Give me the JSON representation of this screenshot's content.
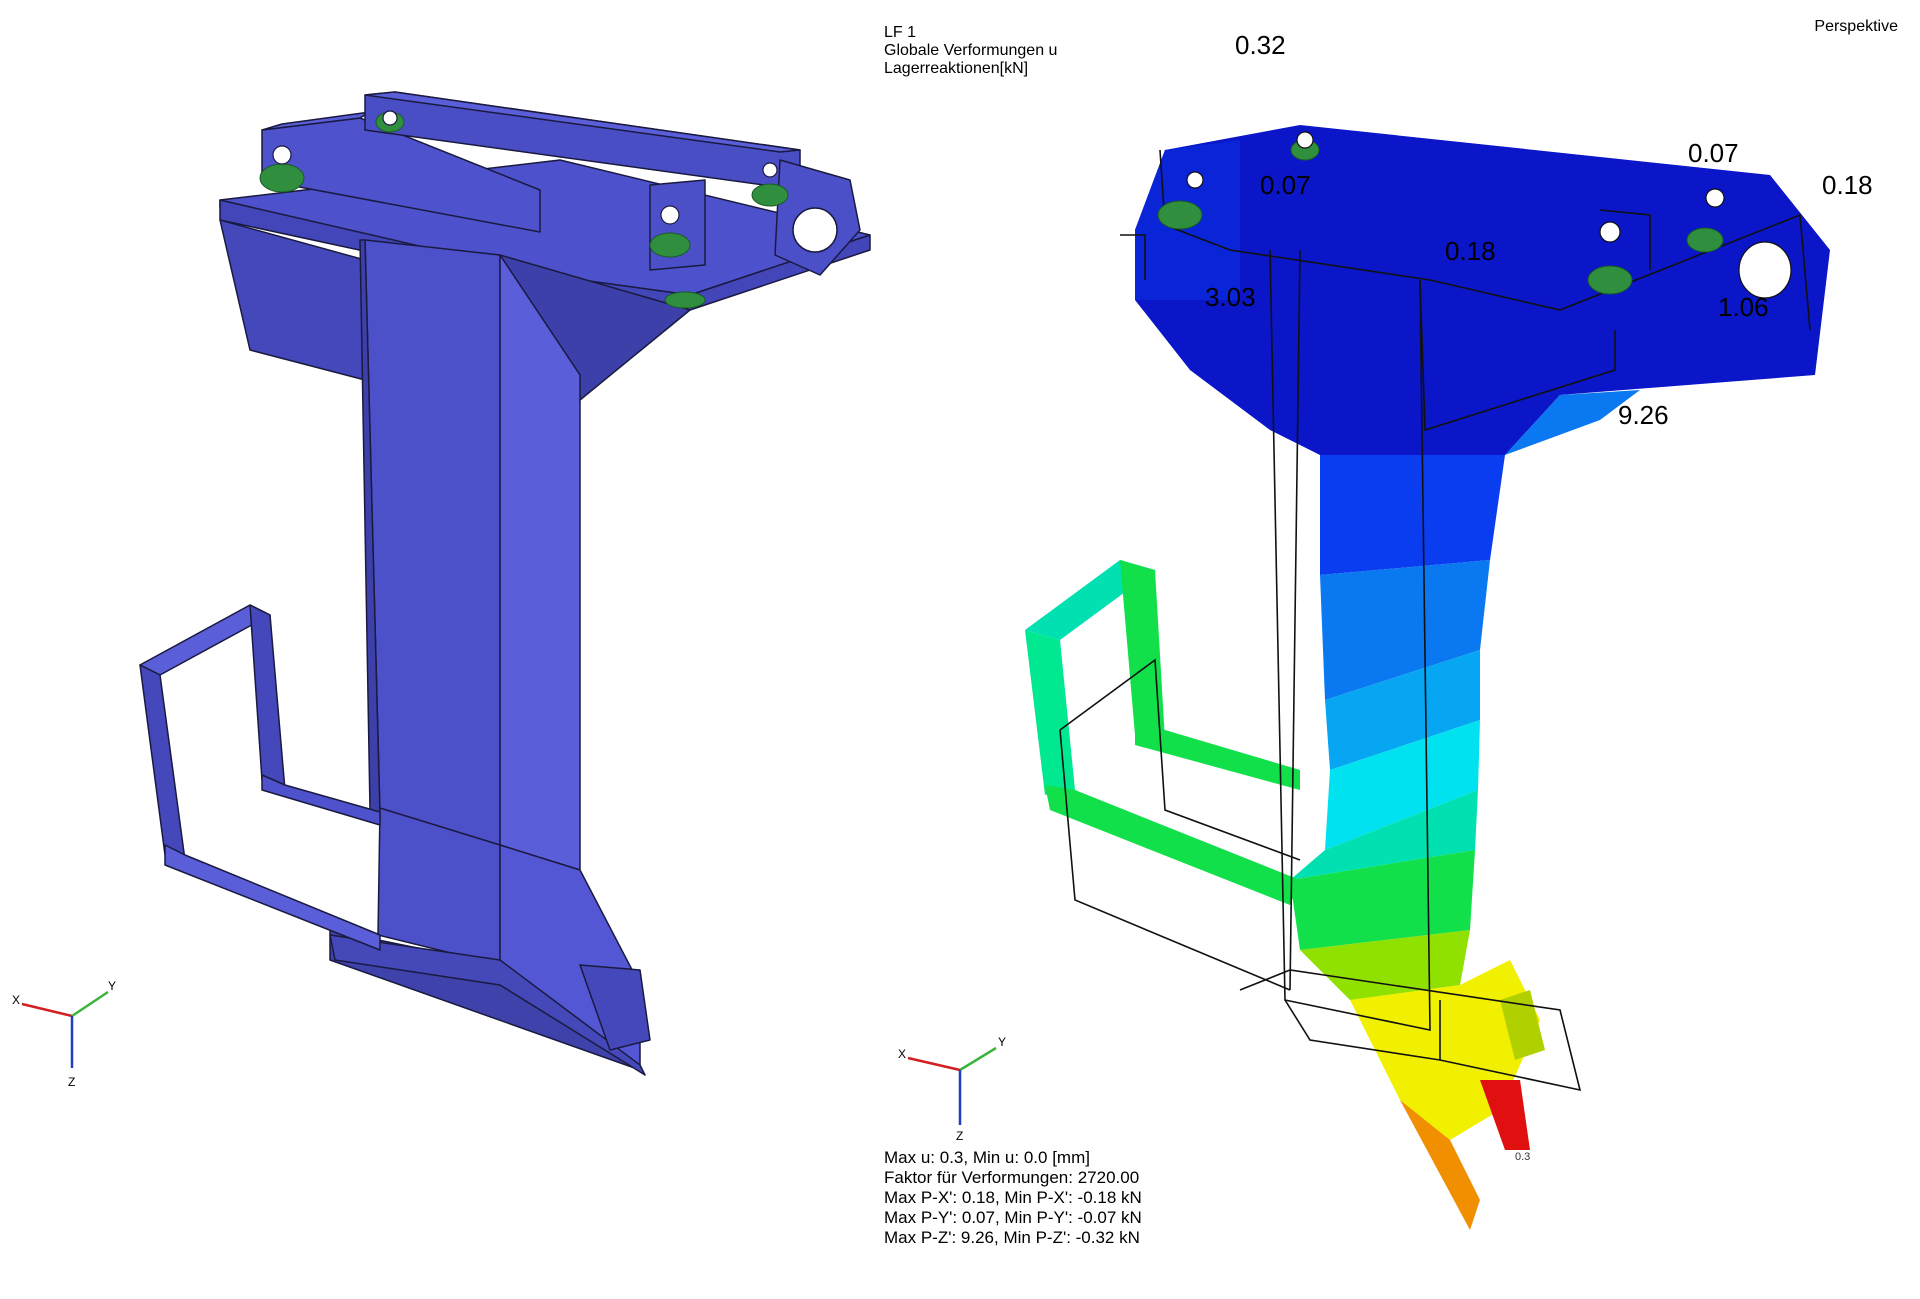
{
  "view": {
    "projection_label": "Perspektive"
  },
  "legend": {
    "load_case": "LF 1",
    "line1": "Globale Verformungen u",
    "line2": "Lagerreaktionen[kN]"
  },
  "reactions": [
    {
      "id": "r1",
      "label": "0.32"
    },
    {
      "id": "r2",
      "label": "0.07"
    },
    {
      "id": "r3",
      "label": "0.07"
    },
    {
      "id": "r4",
      "label": "0.18"
    },
    {
      "id": "r5",
      "label": "0.18"
    },
    {
      "id": "r6",
      "label": "3.03"
    },
    {
      "id": "r7",
      "label": "1.06"
    },
    {
      "id": "r8",
      "label": "9.26"
    }
  ],
  "max_marker": "0.3",
  "stats": {
    "max_u": "Max u: 0.3, Min u: 0.0 [mm]",
    "factor": "Faktor für Verformungen: 2720.00",
    "px": "Max P-X': 0.18, Min P-X': -0.18 kN",
    "py": "Max P-Y': 0.07, Min P-Y': -0.07 kN",
    "pz": "Max P-Z': 9.26, Min P-Z': -0.32 kN"
  },
  "axes": {
    "x_label": "X",
    "y_label": "Y",
    "z_label": "Z",
    "x_color": "#d21f1f",
    "y_color": "#3cb43c",
    "z_color": "#1f3fbf"
  },
  "colors": {
    "model_face": "#4b4fc9",
    "model_face_light": "#5c60da",
    "model_face_dark": "#3d41ad",
    "support_green": "#2f8f3f",
    "contour_blue_dark": "#0a16c8",
    "contour_blue": "#0a3cf0",
    "contour_blue_mid": "#0a78f0",
    "contour_cyan_blue": "#06a6f2",
    "contour_cyan": "#00e2f0",
    "contour_teal": "#00e0b0",
    "contour_green": "#12e04a",
    "contour_lime": "#90e000",
    "contour_yellow": "#f0f000",
    "contour_orange": "#f09000",
    "contour_red": "#e01010"
  }
}
